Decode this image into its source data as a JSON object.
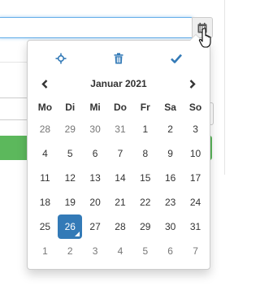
{
  "colors": {
    "accent": "#337ab7",
    "focus_border": "#66afe9",
    "success": "#5cb85c",
    "muted_text": "#777777"
  },
  "input": {
    "value": ""
  },
  "addon": {
    "icon": "calendar-icon"
  },
  "picker": {
    "toolbar": {
      "today_icon": "crosshair-icon",
      "clear_icon": "trash-icon",
      "close_icon": "checkmark-icon"
    },
    "header": {
      "prev_icon": "chevron-left-icon",
      "title": "Januar 2021",
      "next_icon": "chevron-right-icon"
    },
    "weekdays": [
      "Mo",
      "Di",
      "Mi",
      "Do",
      "Fr",
      "Sa",
      "So"
    ],
    "weeks": [
      [
        {
          "d": "28",
          "t": "old"
        },
        {
          "d": "29",
          "t": "old"
        },
        {
          "d": "30",
          "t": "old"
        },
        {
          "d": "31",
          "t": "old"
        },
        {
          "d": "1",
          "t": ""
        },
        {
          "d": "2",
          "t": ""
        },
        {
          "d": "3",
          "t": ""
        }
      ],
      [
        {
          "d": "4",
          "t": ""
        },
        {
          "d": "5",
          "t": ""
        },
        {
          "d": "6",
          "t": ""
        },
        {
          "d": "7",
          "t": ""
        },
        {
          "d": "8",
          "t": ""
        },
        {
          "d": "9",
          "t": ""
        },
        {
          "d": "10",
          "t": ""
        }
      ],
      [
        {
          "d": "11",
          "t": ""
        },
        {
          "d": "12",
          "t": ""
        },
        {
          "d": "13",
          "t": ""
        },
        {
          "d": "14",
          "t": ""
        },
        {
          "d": "15",
          "t": ""
        },
        {
          "d": "16",
          "t": ""
        },
        {
          "d": "17",
          "t": ""
        }
      ],
      [
        {
          "d": "18",
          "t": ""
        },
        {
          "d": "19",
          "t": ""
        },
        {
          "d": "20",
          "t": ""
        },
        {
          "d": "21",
          "t": ""
        },
        {
          "d": "22",
          "t": ""
        },
        {
          "d": "23",
          "t": ""
        },
        {
          "d": "24",
          "t": ""
        }
      ],
      [
        {
          "d": "25",
          "t": ""
        },
        {
          "d": "26",
          "t": "active"
        },
        {
          "d": "27",
          "t": ""
        },
        {
          "d": "28",
          "t": ""
        },
        {
          "d": "29",
          "t": ""
        },
        {
          "d": "30",
          "t": ""
        },
        {
          "d": "31",
          "t": ""
        }
      ],
      [
        {
          "d": "1",
          "t": "new"
        },
        {
          "d": "2",
          "t": "new"
        },
        {
          "d": "3",
          "t": "new"
        },
        {
          "d": "4",
          "t": "new"
        },
        {
          "d": "5",
          "t": "new"
        },
        {
          "d": "6",
          "t": "new"
        },
        {
          "d": "7",
          "t": "new"
        }
      ]
    ]
  }
}
